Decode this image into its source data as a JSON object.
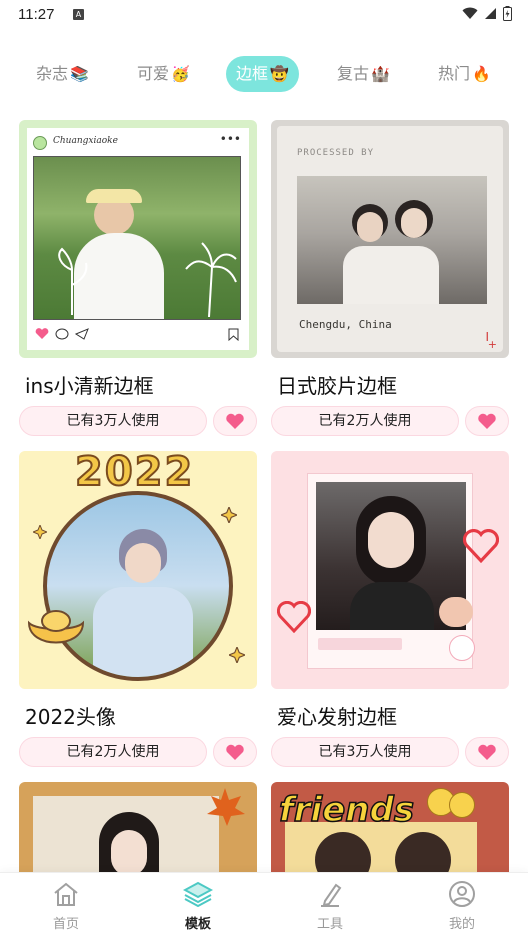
{
  "status_bar": {
    "time": "11:27",
    "notification_letter": "A"
  },
  "tabs": [
    {
      "label": "杂志",
      "emoji": "📚",
      "active": false
    },
    {
      "label": "可爱",
      "emoji": "🥳",
      "active": false
    },
    {
      "label": "边框",
      "emoji": "🤠",
      "active": true
    },
    {
      "label": "复古",
      "emoji": "🏰",
      "active": false
    },
    {
      "label": "热门",
      "emoji": "🔥",
      "active": false
    }
  ],
  "cards": [
    {
      "title": "ins小清新边框",
      "usage": "已有3万人使用",
      "thumb_brand": "Chuangxiaoke"
    },
    {
      "title": "日式胶片边框",
      "usage": "已有2万人使用",
      "thumb_caption_top": "PROCESSED BY",
      "thumb_caption_bottom": "Chengdu, China"
    },
    {
      "title": "2022头像",
      "usage": "已有2万人使用",
      "thumb_year": "2022"
    },
    {
      "title": "爱心发射边框",
      "usage": "已有3万人使用"
    },
    {
      "title": "",
      "usage": ""
    },
    {
      "title": "",
      "usage": "",
      "thumb_text": "friends"
    }
  ],
  "bottom_nav": [
    {
      "label": "首页",
      "icon": "home-icon",
      "active": false
    },
    {
      "label": "模板",
      "icon": "layers-icon",
      "active": true
    },
    {
      "label": "工具",
      "icon": "pen-icon",
      "active": false
    },
    {
      "label": "我的",
      "icon": "user-icon",
      "active": false
    }
  ],
  "colors": {
    "accent": "#7de5dd",
    "heart": "#f45c8c",
    "usage_bg": "#fff0f3",
    "nav_active": "#4cc9c4"
  }
}
